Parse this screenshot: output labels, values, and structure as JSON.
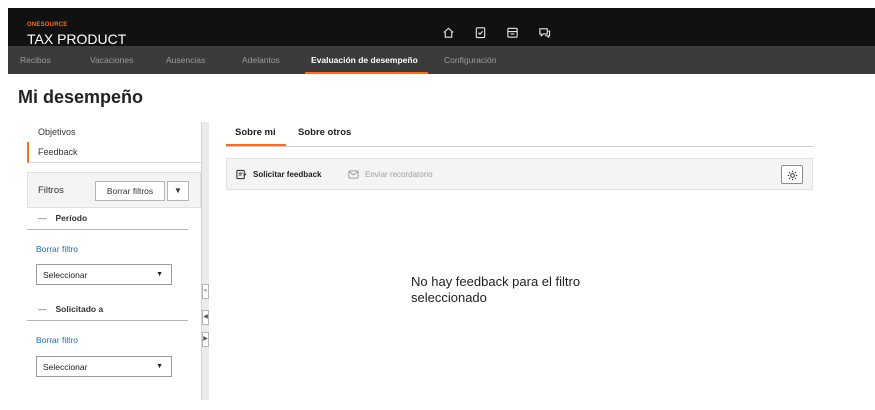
{
  "header": {
    "brand_top": "ONESOURCE",
    "brand_title": "TAX PRODUCT",
    "icons": [
      "home-icon",
      "clipboard-check-icon",
      "inbox-icon",
      "chat-icon"
    ]
  },
  "nav": {
    "items": [
      {
        "label": "Recibos",
        "active": false
      },
      {
        "label": "Vacaciones",
        "active": false
      },
      {
        "label": "Ausencias",
        "active": false
      },
      {
        "label": "Adelantos",
        "active": false
      },
      {
        "label": "Evaluación de desempeño",
        "active": true
      },
      {
        "label": "Configuración",
        "active": false
      }
    ]
  },
  "page": {
    "title": "Mi desempeño"
  },
  "sidebar": {
    "items": [
      {
        "label": "Objetivos",
        "selected": false
      },
      {
        "label": "Feedback",
        "selected": true
      }
    ],
    "filters": {
      "label": "Filtros",
      "clear_all_label": "Borrar filtros",
      "sections": [
        {
          "title": "Período",
          "clear_label": "Borrar filtro",
          "select_value": "Seleccionar"
        },
        {
          "title": "Solicitado a",
          "clear_label": "Borrar filtro",
          "select_value": "Seleccionar"
        }
      ]
    }
  },
  "content": {
    "tabs": [
      {
        "label": "Sobre mi",
        "active": true
      },
      {
        "label": "Sobre otros",
        "active": false
      }
    ],
    "toolbar": {
      "request_feedback": "Solicitar feedback",
      "send_reminder": "Enviar recordatorio"
    },
    "empty_message": "No hay feedback para el filtro seleccionado"
  },
  "colors": {
    "accent": "#ff6b1a",
    "header_bg": "#111111",
    "nav_bg": "#3b3b3b",
    "link": "#1a6fb5"
  }
}
